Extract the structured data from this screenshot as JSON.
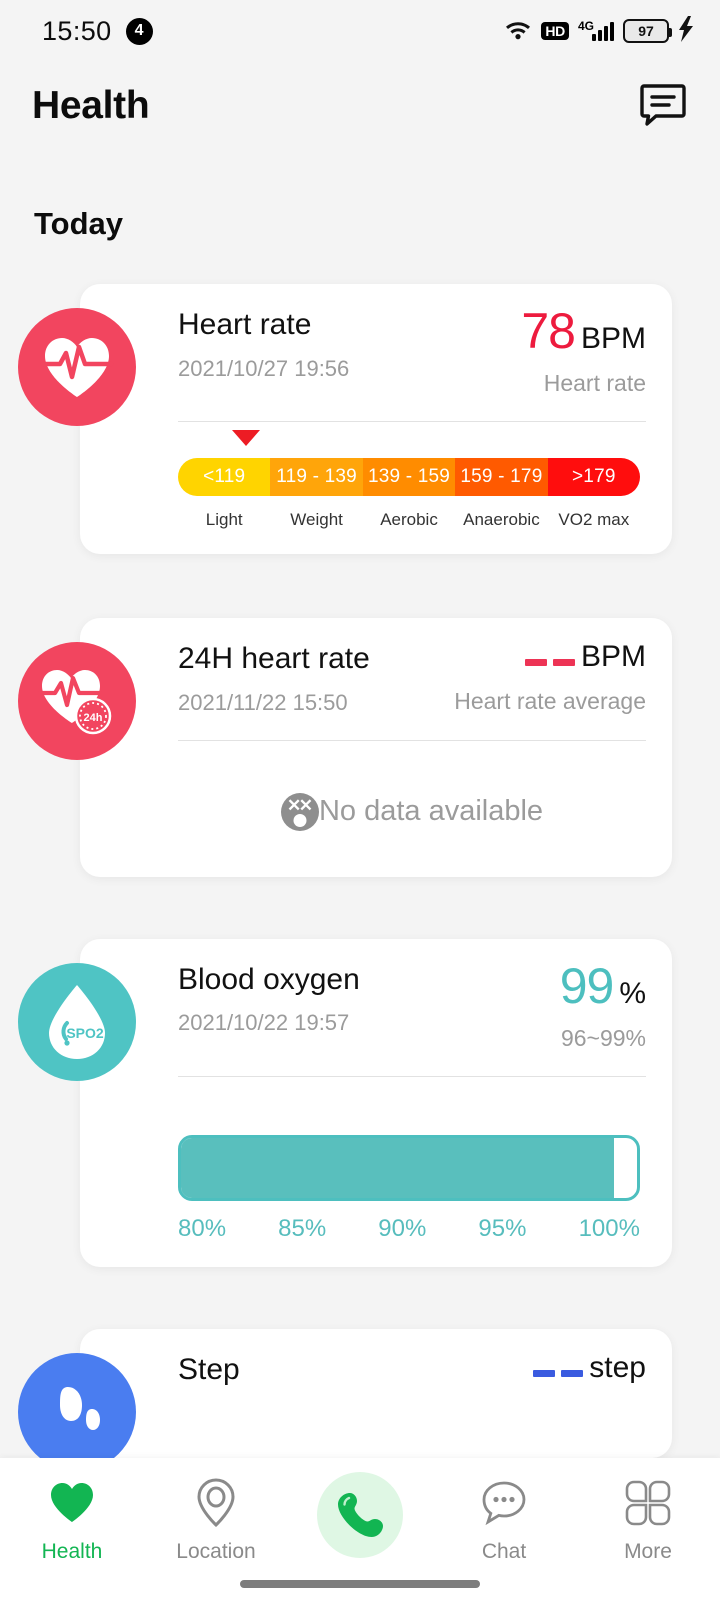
{
  "status_bar": {
    "time": "15:50",
    "notification_count": "4",
    "wifi_icon": "wifi-icon",
    "hd_label": "HD",
    "network_label": "4G",
    "battery_level": "97",
    "charging_icon": "charging-bolt-icon"
  },
  "header": {
    "title": "Health",
    "message_icon": "message-bubble-icon"
  },
  "section": {
    "title": "Today"
  },
  "cards": {
    "heart_rate": {
      "icon": "heart-rate-icon",
      "name": "Heart rate",
      "date": "2021/10/27 19:56",
      "value": "78",
      "unit": "BPM",
      "sub": "Heart rate",
      "marker_position_pct": 14,
      "zones": [
        {
          "range": "<119",
          "label": "Light",
          "color": "#FFD400"
        },
        {
          "range": "119 - 139",
          "label": "Weight",
          "color": "#FFA50A"
        },
        {
          "range": "139 - 159",
          "label": "Aerobic",
          "color": "#FF8C00"
        },
        {
          "range": "159 - 179",
          "label": "Anaerobic",
          "color": "#FF5A00"
        },
        {
          "range": ">179",
          "label": "VO2 max",
          "color": "#FF0D0D"
        }
      ]
    },
    "heart_rate_24h": {
      "icon": "heart-rate-24h-icon",
      "name": "24H heart rate",
      "date": "2021/11/22 15:50",
      "value": "--",
      "unit": "BPM",
      "sub": "Heart rate average",
      "empty_icon": "dizzy-face-icon",
      "empty_text": "No data available"
    },
    "blood_oxygen": {
      "icon": "spo2-droplet-icon",
      "icon_label": "SPO2",
      "name": "Blood oxygen",
      "date": "2021/10/22 19:57",
      "value": "99",
      "unit": "%",
      "sub": "96~99%",
      "fill_pct": 95,
      "scale": [
        "80%",
        "85%",
        "90%",
        "95%",
        "100%"
      ]
    },
    "step": {
      "icon": "step-icon",
      "name": "Step",
      "value": "--",
      "unit": "step"
    }
  },
  "bottom_nav": {
    "items": [
      {
        "label": "Health",
        "icon": "heart-icon"
      },
      {
        "label": "Location",
        "icon": "location-pin-icon"
      },
      {
        "label": "",
        "icon": "phone-call-icon"
      },
      {
        "label": "Chat",
        "icon": "chat-bubble-icon"
      },
      {
        "label": "More",
        "icon": "grid-petals-icon"
      }
    ]
  },
  "colors": {
    "accent_red": "#ED1B3E",
    "accent_teal": "#4DBFBF",
    "accent_blue": "#3A6FE0",
    "nav_active": "#12B552"
  }
}
